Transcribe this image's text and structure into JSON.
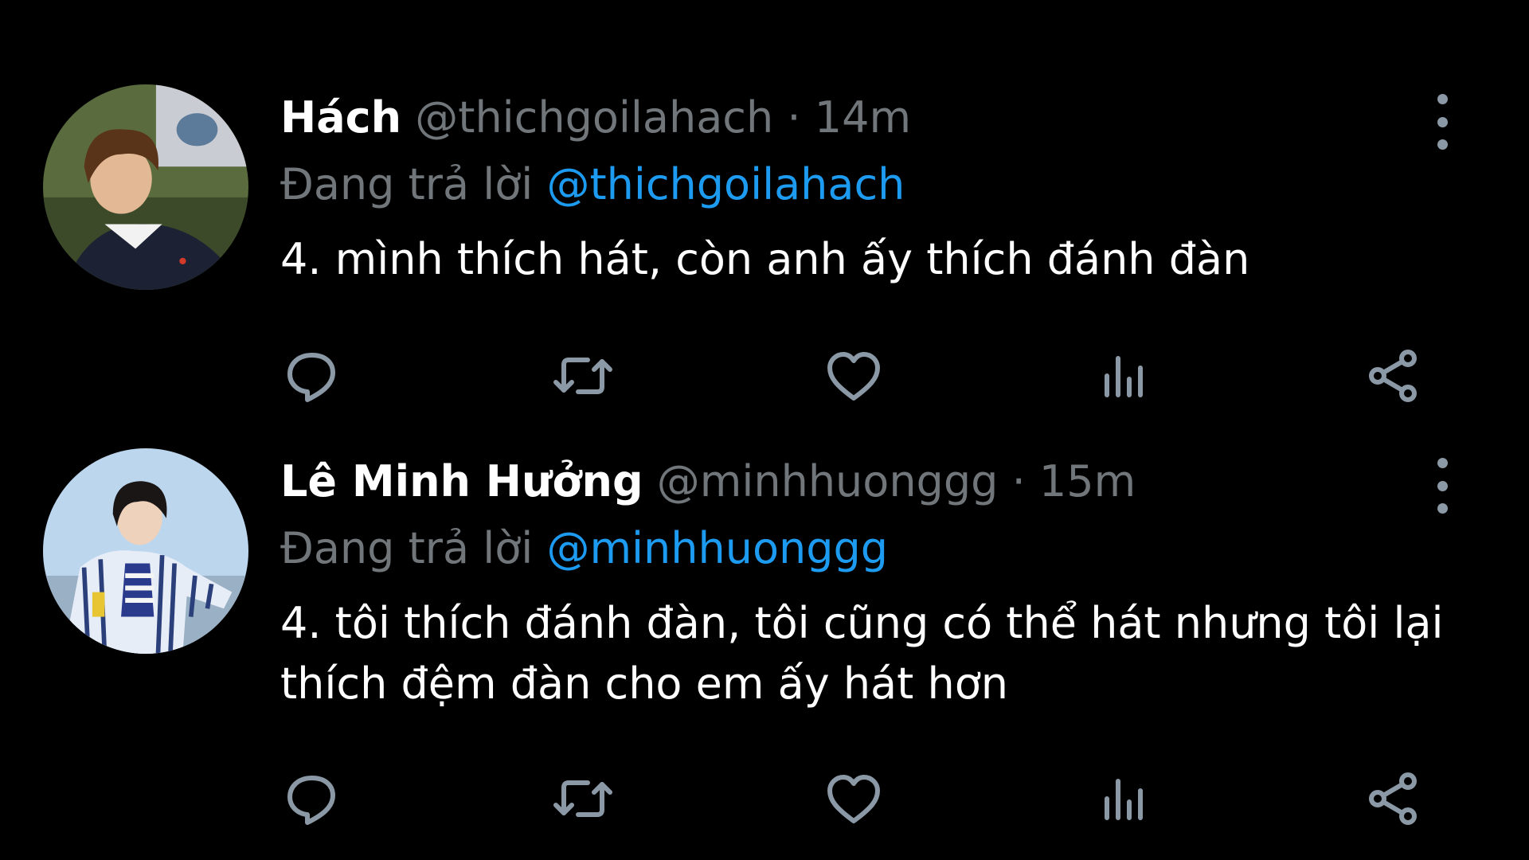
{
  "tweets": [
    {
      "display_name": "Hách",
      "handle": "@thichgoilahach",
      "separator": "·",
      "time": "14m",
      "reply_prefix": "Đang trả lời",
      "reply_to": "@thichgoilahach",
      "text": "4. mình thích hát, còn anh ấy thích đánh đàn",
      "avatar_icon": "user-avatar-photo"
    },
    {
      "display_name": "Lê Minh Hưởng",
      "handle": "@minhhuonggg",
      "separator": "·",
      "time": "15m",
      "reply_prefix": "Đang trả lời",
      "reply_to": "@minhhuonggg",
      "text": "4. tôi thích đánh đàn, tôi cũng có thể hát nhưng tôi lại thích đệm đàn cho em ấy hát hơn",
      "avatar_icon": "user-avatar-photo"
    }
  ],
  "actions": [
    "reply-icon",
    "retweet-icon",
    "like-icon",
    "views-icon",
    "share-icon"
  ],
  "colors": {
    "background": "#000000",
    "text_primary": "#ffffff",
    "text_secondary": "#71767b",
    "link": "#1d9bf0",
    "icon": "#8b98a5"
  }
}
